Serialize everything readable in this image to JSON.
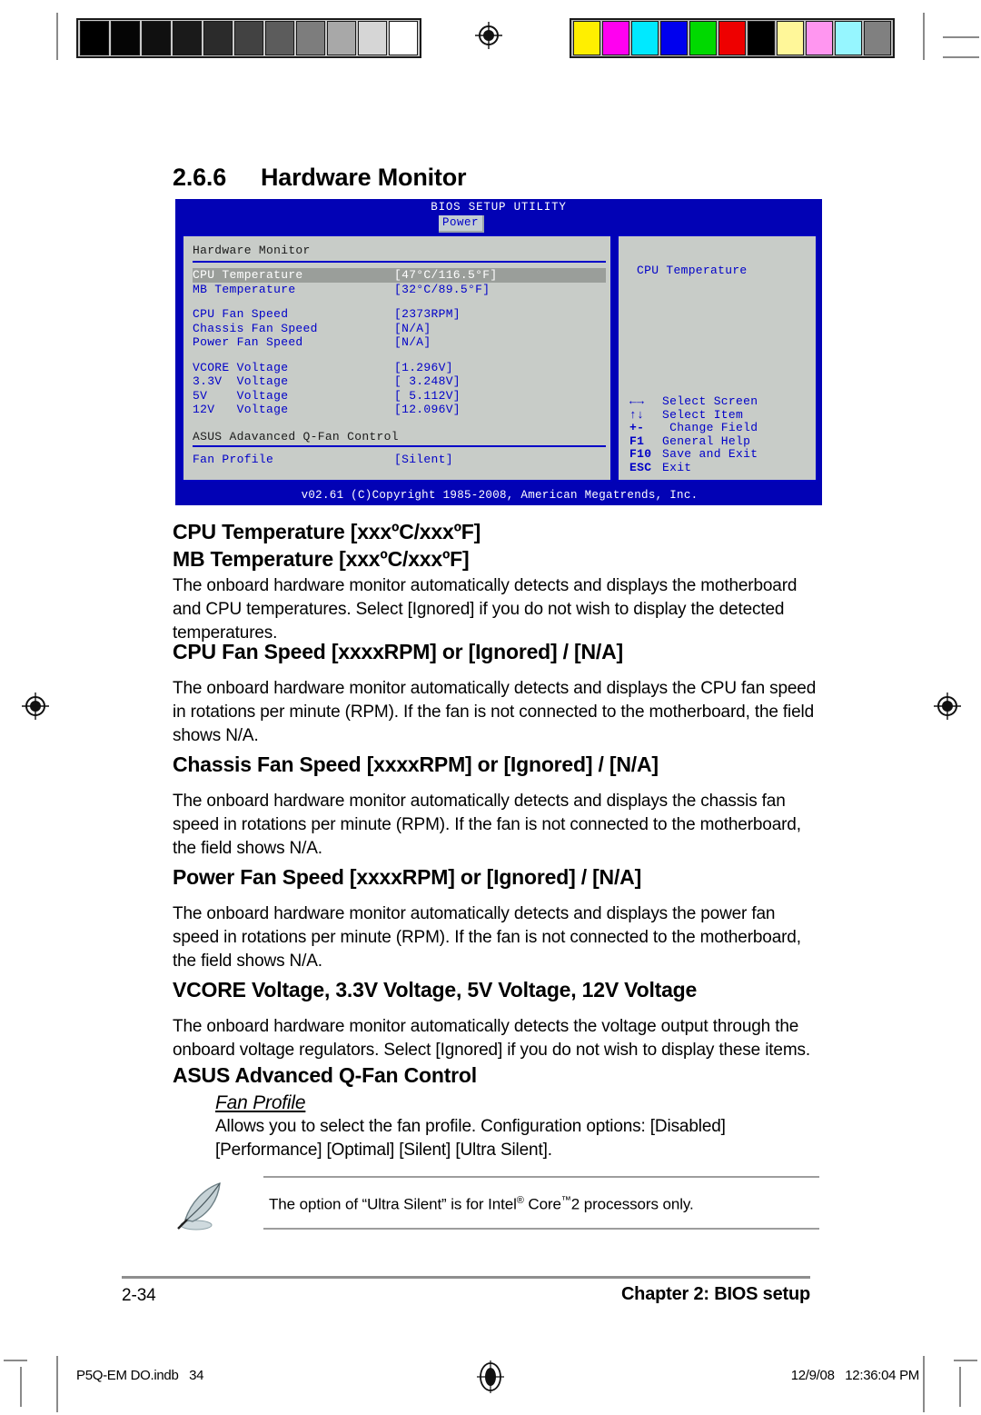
{
  "section": {
    "number": "2.6.6",
    "title": "Hardware Monitor"
  },
  "bios": {
    "title": "BIOS SETUP UTILITY",
    "active_tab": "Power",
    "panel_title": "Hardware Monitor",
    "group_title": "ASUS Adavanced Q-Fan Control",
    "rows": [
      {
        "label": "CPU Temperature",
        "value": "[47°C/116.5°F]",
        "selected": true
      },
      {
        "label": "MB Temperature",
        "value": "[32°C/89.5°F]",
        "selected": false
      },
      {
        "label": "CPU Fan Speed",
        "value": "[2373RPM]",
        "selected": false
      },
      {
        "label": "Chassis Fan Speed",
        "value": "[N/A]",
        "selected": false
      },
      {
        "label": "Power Fan Speed",
        "value": "[N/A]",
        "selected": false
      },
      {
        "label": "VCORE Voltage",
        "value": "[1.296V]",
        "selected": false
      },
      {
        "label": "3.3V  Voltage",
        "value": "[ 3.248V]",
        "selected": false
      },
      {
        "label": "5V    Voltage",
        "value": "[ 5.112V]",
        "selected": false
      },
      {
        "label": "12V   Voltage",
        "value": "[12.096V]",
        "selected": false
      },
      {
        "label": "Fan Profile",
        "value": "[Silent]",
        "selected": false
      }
    ],
    "help_text": "CPU Temperature",
    "legend": [
      {
        "key": "←→",
        "desc": "Select Screen"
      },
      {
        "key": "↑↓",
        "desc": "Select Item"
      },
      {
        "key": "+-",
        "desc": " Change Field"
      },
      {
        "key": "F1",
        "desc": "General Help"
      },
      {
        "key": "F10",
        "desc": "Save and Exit"
      },
      {
        "key": "ESC",
        "desc": "Exit"
      }
    ],
    "footer": "v02.61 (C)Copyright 1985-2008, American Megatrends, Inc.",
    "colors": {
      "screen_blue": "#0202b5",
      "panel_gray": "#c8ccc8",
      "text_blue": "#0000c8",
      "tab_bg": "#c3cdd3",
      "selected_bg": "#9a9e9a"
    }
  },
  "topics": [
    {
      "heading_line1": "CPU Temperature [xxxºC/xxxºF]",
      "heading_line2": "MB Temperature [xxxºC/xxxºF]",
      "body": "The onboard hardware monitor automatically detects and displays the motherboard and CPU temperatures. Select [Ignored] if you do not wish to display the detected temperatures."
    },
    {
      "heading_line1": "CPU Fan Speed [xxxxRPM] or [Ignored] / [N/A]",
      "body": "The onboard hardware monitor automatically detects and displays the CPU fan speed in rotations per minute (RPM). If the fan is not connected to the motherboard, the field shows N/A."
    },
    {
      "heading_line1": "Chassis Fan Speed [xxxxRPM] or [Ignored] / [N/A]",
      "body": "The onboard hardware monitor automatically detects and displays the chassis fan speed in rotations per minute (RPM). If the fan is not connected to the motherboard, the field shows N/A."
    },
    {
      "heading_line1": "Power Fan Speed [xxxxRPM] or [Ignored] / [N/A]",
      "body": "The onboard hardware monitor automatically detects and displays the power fan speed in rotations per minute (RPM). If the fan is not connected to the motherboard, the field shows N/A."
    },
    {
      "heading_line1": "VCORE Voltage, 3.3V Voltage, 5V Voltage, 12V Voltage",
      "body": "The onboard hardware monitor automatically detects the voltage output through the onboard voltage regulators. Select [Ignored] if you do not wish to display these items."
    }
  ],
  "qfan": {
    "heading": "ASUS Advanced Q-Fan Control",
    "sub_heading": "Fan Profile",
    "body": "Allows you to select the fan profile. Configuration options: [Disabled] [Performance] [Optimal] [Silent] [Ultra Silent]."
  },
  "note": {
    "text_before": "The option of “Ultra Silent” is for Intel",
    "sup1": "®",
    "text_mid": " Core",
    "sup2": "™",
    "text_after": "2 processors only."
  },
  "page_footer": {
    "page_number": "2-34",
    "chapter": "Chapter 2: BIOS setup"
  },
  "production": {
    "file_label": "P5Q-EM DO.indb   34",
    "timestamp": "12/9/08   12:36:04 PM",
    "gray_wedge": [
      "#000000",
      "#050505",
      "#101010",
      "#1a1a1a",
      "#2b2b2b",
      "#424242",
      "#5c5c5c",
      "#7d7d7d",
      "#a8a8a8",
      "#d6d6d6",
      "#ffffff"
    ],
    "color_bar": [
      "#ffef00",
      "#ff00f0",
      "#00e9ff",
      "#0000ee",
      "#00d900",
      "#ee0000",
      "#000000",
      "#fff799",
      "#ff96f0",
      "#96f6ff",
      "#808080"
    ]
  }
}
